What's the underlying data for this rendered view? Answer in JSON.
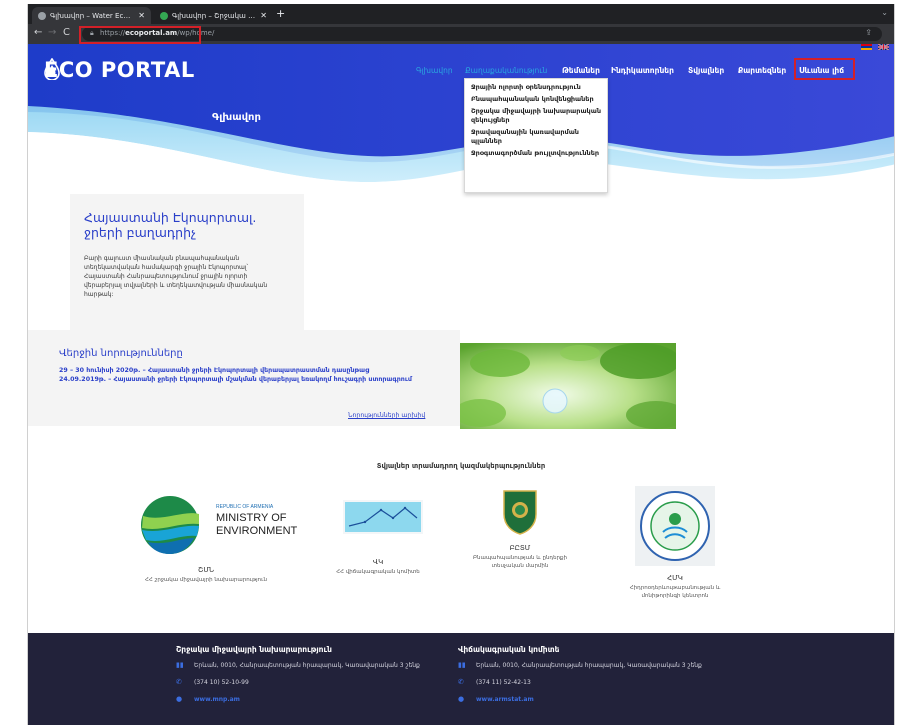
{
  "browser": {
    "tabs": [
      {
        "title": "Գլխավոր – Water Ecoportal of",
        "active": true
      },
      {
        "title": "Գլխավոր – Շրջակա միջավայ",
        "active": false
      }
    ],
    "new_tab_glyph": "+",
    "address": {
      "scheme": "https://",
      "domain": "ecoportal.am",
      "path": "/wp/home/"
    }
  },
  "site": {
    "logo_text": "ECO PORTAL",
    "nav": [
      "Գլխավոր",
      "Քաղաքականություն",
      "Թեմաներ",
      "Ինդիկատորներ",
      "Տվյալներ",
      "Քարտեզներ",
      "Սևանա լիճ"
    ],
    "dropdown": [
      "Ջրային ոլորտի օրենսդրություն",
      "Բնապահպանական կոնվենցիաներ",
      "Շրջակա միջավայրի նախարարական զեկույցներ",
      "Ջրավազանային կառավարման պլաններ",
      "Ջրօգտագործման թույլտվություններ"
    ],
    "hero_title": "Գլխավոր"
  },
  "intro": {
    "title": "Հայաստանի Էկոպորտալ. ջրերի բաղադրիչ",
    "body": "Բարի գալուստ միասնական բնապահպանական տեղեկատվական համակարգի ջրային Էկոպորտալ՝ Հայաստանի Հանրապետությունում ջրային ոլորտի վերաբերյալ տվյալների և տեղեկատվության միասնական հարթակ:"
  },
  "news": {
    "heading": "Վերջին նորությունները",
    "items": [
      "29 – 30 հունիսի 2020թ. – Հայաստանի ջրերի Էկոպորտալի վերապատրաստման դասընթաց",
      "24.09.2019թ. – Հայաստանի ջրերի Էկոպորտալի մշակման վերաբերյալ եռակողմ հուշագրի ստորագրում"
    ],
    "more_link": "Նորությունների արխիվ"
  },
  "partners": {
    "title": "Տվյալներ տրամադրող կազմակերպություններ",
    "list": [
      {
        "abbr": "ՇՄՆ",
        "name": "ՀՀ շրջակա միջավայրի նախարարություն",
        "logo_lines": [
          "REPUBLIC OF ARMENIA",
          "MINISTRY OF",
          "ENVIRONMENT"
        ]
      },
      {
        "abbr": "ՎԿ",
        "name": "ՀՀ վիճակագրական կոմիտե"
      },
      {
        "abbr": "ԲԸՏՄ",
        "name": "Բնապահպանության և ընդերքի տեսչական մարմին"
      },
      {
        "abbr": "ՀՄԿ",
        "name": "Հիդրոօդերևութաբանության և մոնիթորինգի կենտրոն"
      }
    ]
  },
  "footer": {
    "columns": [
      {
        "title": "Շրջակա միջավայրի նախարարություն",
        "address": "Երևան, 0010, Հանրապետության հրապարակ, Կառավարական 3 շենք",
        "phone": "(374 10) 52-10-99",
        "web": "www.mnp.am"
      },
      {
        "title": "Վիճակագրական կոմիտե",
        "address": "Երևան, 0010, Հանրապետության հրապարակ, Կառավարական 3 շենք",
        "phone": "(374 11) 52-42-13",
        "web": "www.armstat.am"
      }
    ]
  },
  "colors": {
    "accent": "#2a3fc9",
    "hero": "#2f3fd0",
    "footer": "#22223a",
    "highlight": "#d32028"
  }
}
